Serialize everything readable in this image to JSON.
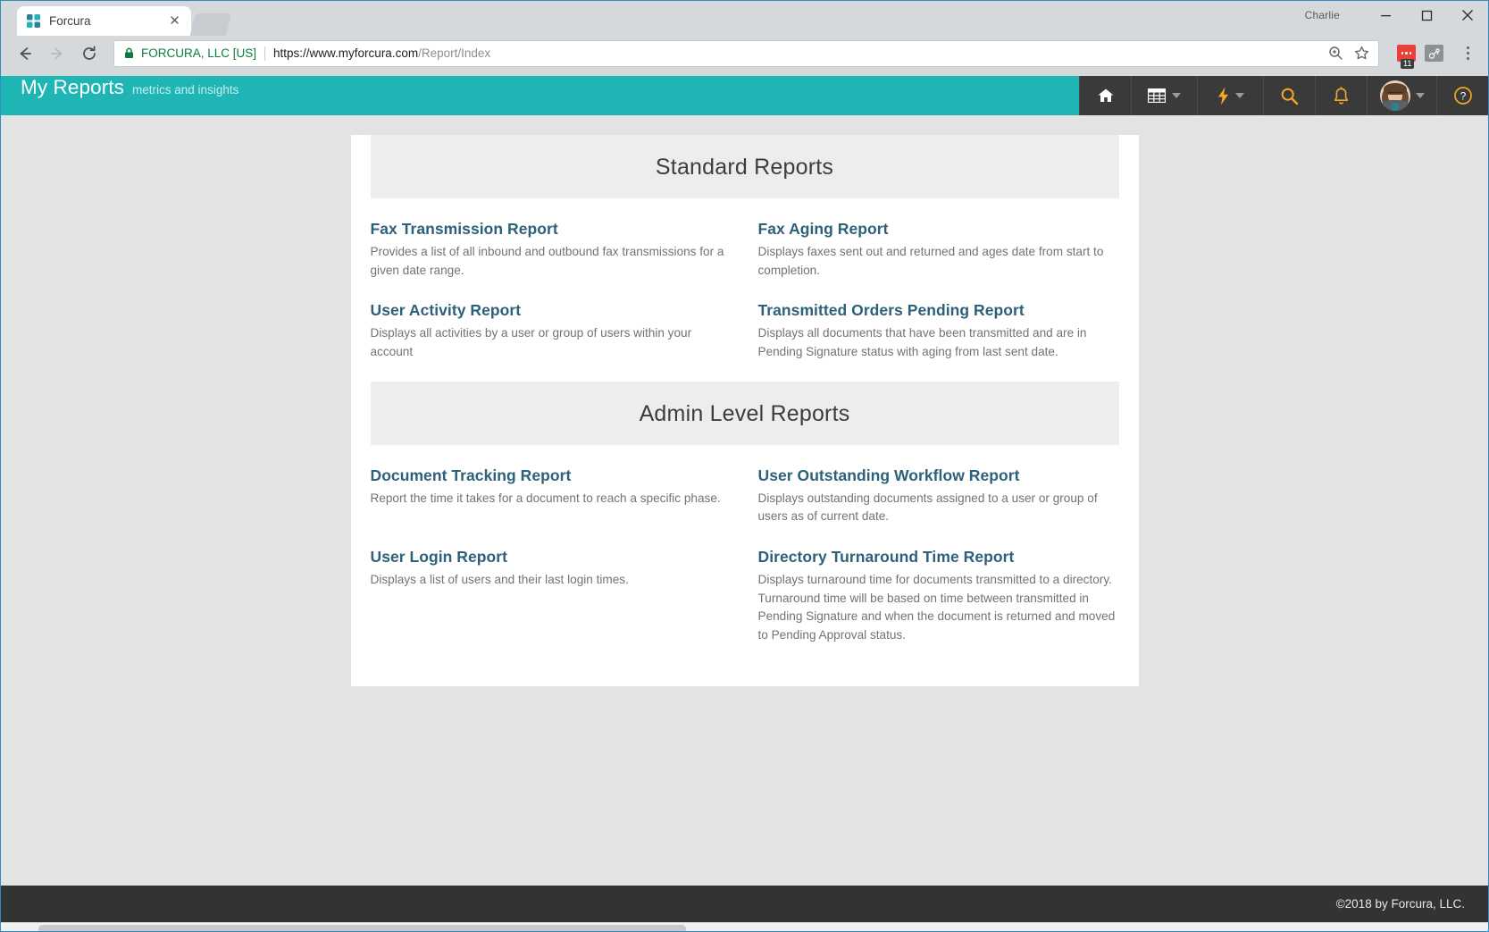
{
  "window": {
    "user_label": "Charlie",
    "minimize_label": "Minimize",
    "maximize_label": "Maximize",
    "close_label": "Close"
  },
  "browser": {
    "tab_title": "Forcura",
    "tab_close_glyph": "✕",
    "security_label": "FORCURA, LLC [US]",
    "url_host": "https://www.myforcura.com",
    "url_path": "/Report/Index",
    "extension_badge": "11",
    "back_label": "Back",
    "forward_label": "Forward",
    "reload_label": "Reload"
  },
  "app_header": {
    "brand_title": "My Reports",
    "brand_subtitle": "metrics and insights",
    "accent_color": "#1fb5b5",
    "nav_bg_color": "#3a3a3a",
    "nav_items": [
      {
        "name": "home",
        "label": "Home"
      },
      {
        "name": "apps",
        "label": "Apps"
      },
      {
        "name": "quick-actions",
        "label": "Quick Actions"
      },
      {
        "name": "search",
        "label": "Search"
      },
      {
        "name": "notifications",
        "label": "Notifications"
      },
      {
        "name": "user-menu",
        "label": "User Menu"
      },
      {
        "name": "help",
        "label": "Help"
      }
    ]
  },
  "main": {
    "sections": [
      {
        "heading": "Standard Reports",
        "reports": [
          {
            "title": "Fax Transmission Report",
            "description": "Provides a list of all inbound and outbound fax transmissions for a given date range."
          },
          {
            "title": "Fax Aging Report",
            "description": "Displays faxes sent out and returned and ages date from start to completion."
          },
          {
            "title": "User Activity Report",
            "description": "Displays all activities by a user or group of users within your account"
          },
          {
            "title": "Transmitted Orders Pending Report",
            "description": "Displays all documents that have been transmitted and are in Pending Signature status with aging from last sent date."
          }
        ]
      },
      {
        "heading": "Admin Level Reports",
        "reports": [
          {
            "title": "Document Tracking Report",
            "description": "Report the time it takes for a document to reach a specific phase."
          },
          {
            "title": "User Outstanding Workflow Report",
            "description": "Displays outstanding documents assigned to a user or group of users as of current date."
          },
          {
            "title": "User Login Report",
            "description": "Displays a list of users and their last login times."
          },
          {
            "title": "Directory Turnaround Time Report",
            "description": "Displays turnaround time for documents transmitted to a directory. Turnaround time will be based on time between transmitted in Pending Signature and when the document is returned and moved to Pending Approval status."
          }
        ]
      }
    ]
  },
  "footer": {
    "copyright": "©2018 by Forcura, LLC."
  }
}
